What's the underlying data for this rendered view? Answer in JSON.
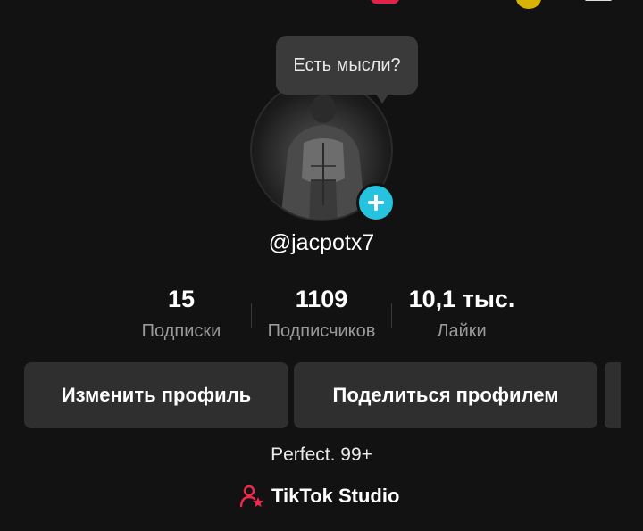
{
  "tooltip": {
    "text": "Есть мысли?"
  },
  "profile": {
    "username": "@jacpotx7",
    "bio": "Perfect. 99+"
  },
  "stats": [
    {
      "value": "15",
      "label": "Подписки"
    },
    {
      "value": "1109",
      "label": "Подписчиков"
    },
    {
      "value": "10,1 тыс.",
      "label": "Лайки"
    }
  ],
  "buttons": {
    "edit": "Изменить профиль",
    "share": "Поделиться профилем"
  },
  "studio": {
    "label": "TikTok Studio"
  },
  "icons": {
    "add": "plus-icon",
    "studio": "user-star-icon"
  },
  "colors": {
    "background": "#121212",
    "add_button": "#25c3e0",
    "studio_icon": "#f2294e",
    "button_bg": "#2f2f2f"
  }
}
